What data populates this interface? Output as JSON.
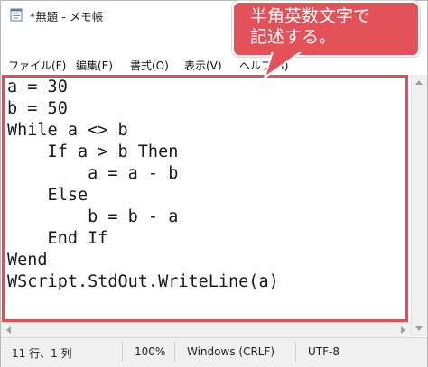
{
  "window": {
    "title": "*無題 - メモ帳",
    "icon": "notepad-icon"
  },
  "menu": {
    "items": [
      {
        "label": "ファイル(F)"
      },
      {
        "label": "編集(E)"
      },
      {
        "label": "書式(O)"
      },
      {
        "label": "表示(V)"
      },
      {
        "label": "ヘルプ(H)"
      }
    ]
  },
  "editor": {
    "lines": [
      "a = 30",
      "b = 50",
      "While a <> b",
      "    If a > b Then",
      "        a = a - b",
      "    Else",
      "        b = b - a",
      "    End If",
      "Wend",
      "WScript.StdOut.WriteLine(a)"
    ]
  },
  "status": {
    "position": "11 行、1 列",
    "zoom": "100%",
    "line_ending": "Windows (CRLF)",
    "encoding": "UTF-8"
  },
  "callout": {
    "line1": "半角英数文字で",
    "line2": "記述する。"
  },
  "colors": {
    "callout": "#e35259",
    "highlight_border": "#e24d56"
  }
}
